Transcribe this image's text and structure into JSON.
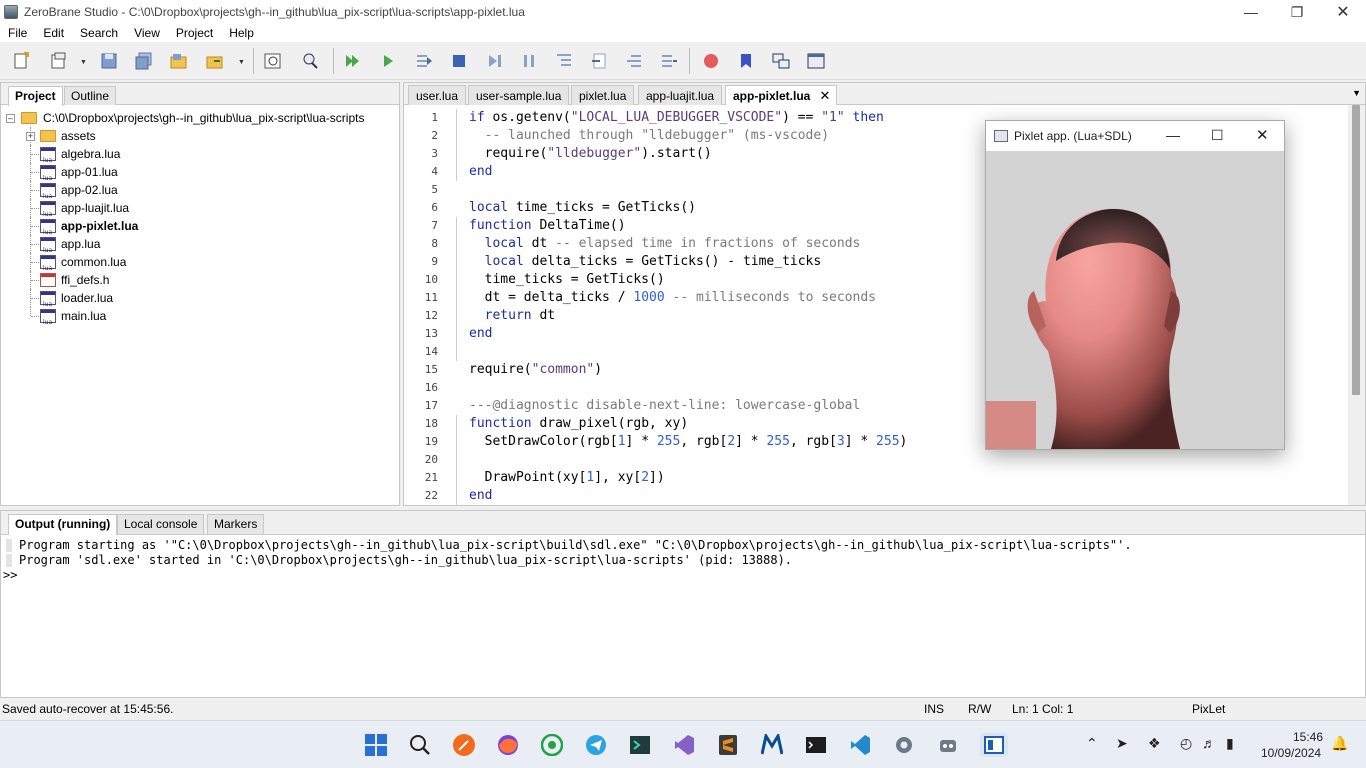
{
  "window": {
    "title": "ZeroBrane Studio - C:\\0\\Dropbox\\projects\\gh--in_github\\lua_pix-script\\lua-scripts\\app-pixlet.lua"
  },
  "menu": [
    "File",
    "Edit",
    "Search",
    "View",
    "Project",
    "Help"
  ],
  "left_tabs": [
    "Project",
    "Outline"
  ],
  "project": {
    "root": "C:\\0\\Dropbox\\projects\\gh--in_github\\lua_pix-script\\lua-scripts",
    "folder": "assets",
    "files": [
      "algebra.lua",
      "app-01.lua",
      "app-02.lua",
      "app-luajit.lua",
      "app-pixlet.lua",
      "app.lua",
      "common.lua",
      "ffi_defs.h",
      "loader.lua",
      "main.lua"
    ],
    "icon_text": "lua"
  },
  "editor_tabs": [
    "user.lua",
    "user-sample.lua",
    "pixlet.lua",
    "app-luajit.lua",
    "app-pixlet.lua"
  ],
  "code_lines": [
    {
      "n": "1",
      "t": "if os.getenv(\"LOCAL_LUA_DEBUGGER_VSCODE\") == \"1\" then"
    },
    {
      "n": "2",
      "t": "  -- launched through \"lldebugger\" (ms-vscode)"
    },
    {
      "n": "3",
      "t": "  require(\"lldebugger\").start()"
    },
    {
      "n": "4",
      "t": "end"
    },
    {
      "n": "5",
      "t": ""
    },
    {
      "n": "6",
      "t": "local time_ticks = GetTicks()"
    },
    {
      "n": "7",
      "t": "function DeltaTime()"
    },
    {
      "n": "8",
      "t": "  local dt -- elapsed time in fractions of seconds"
    },
    {
      "n": "9",
      "t": "  local delta_ticks = GetTicks() - time_ticks"
    },
    {
      "n": "10",
      "t": "  time_ticks = GetTicks()"
    },
    {
      "n": "11",
      "t": "  dt = delta_ticks / 1000 -- milliseconds to seconds"
    },
    {
      "n": "12",
      "t": "  return dt"
    },
    {
      "n": "13",
      "t": "end"
    },
    {
      "n": "14",
      "t": ""
    },
    {
      "n": "15",
      "t": "require(\"common\")"
    },
    {
      "n": "16",
      "t": ""
    },
    {
      "n": "17",
      "t": "---@diagnostic disable-next-line: lowercase-global"
    },
    {
      "n": "18",
      "t": "function draw_pixel(rgb, xy)"
    },
    {
      "n": "19",
      "t": "  SetDrawColor(rgb[1] * 255, rgb[2] * 255, rgb[3] * 255)"
    },
    {
      "n": "20",
      "t": ""
    },
    {
      "n": "21",
      "t": "  DrawPoint(xy[1], xy[2])"
    },
    {
      "n": "22",
      "t": "end"
    }
  ],
  "pixlet_window": {
    "title": "Pixlet app. (Lua+SDL)"
  },
  "bottom_tabs": [
    "Output (running)",
    "Local console",
    "Markers"
  ],
  "output_lines": [
    "Program starting as '\"C:\\0\\Dropbox\\projects\\gh--in_github\\lua_pix-script\\build\\sdl.exe\" \"C:\\0\\Dropbox\\projects\\gh--in_github\\lua_pix-script\\lua-scripts\"'.",
    "Program 'sdl.exe' started in 'C:\\0\\Dropbox\\projects\\gh--in_github\\lua_pix-script\\lua-scripts' (pid: 13888)."
  ],
  "prompt": ">>",
  "status": {
    "message": "Saved auto-recover at 15:45:56.",
    "ins": "INS",
    "rw": "R/W",
    "pos": "Ln: 1 Col: 1",
    "interpreter": "PixLet"
  },
  "clock": {
    "time": "15:46",
    "date": "10/09/2024"
  },
  "colors": {
    "keyword": "#1d2ca6",
    "string": "#5a3c7b",
    "comment": "#7a7a7a",
    "number": "#2f5fcf",
    "head": "#e58a86"
  }
}
